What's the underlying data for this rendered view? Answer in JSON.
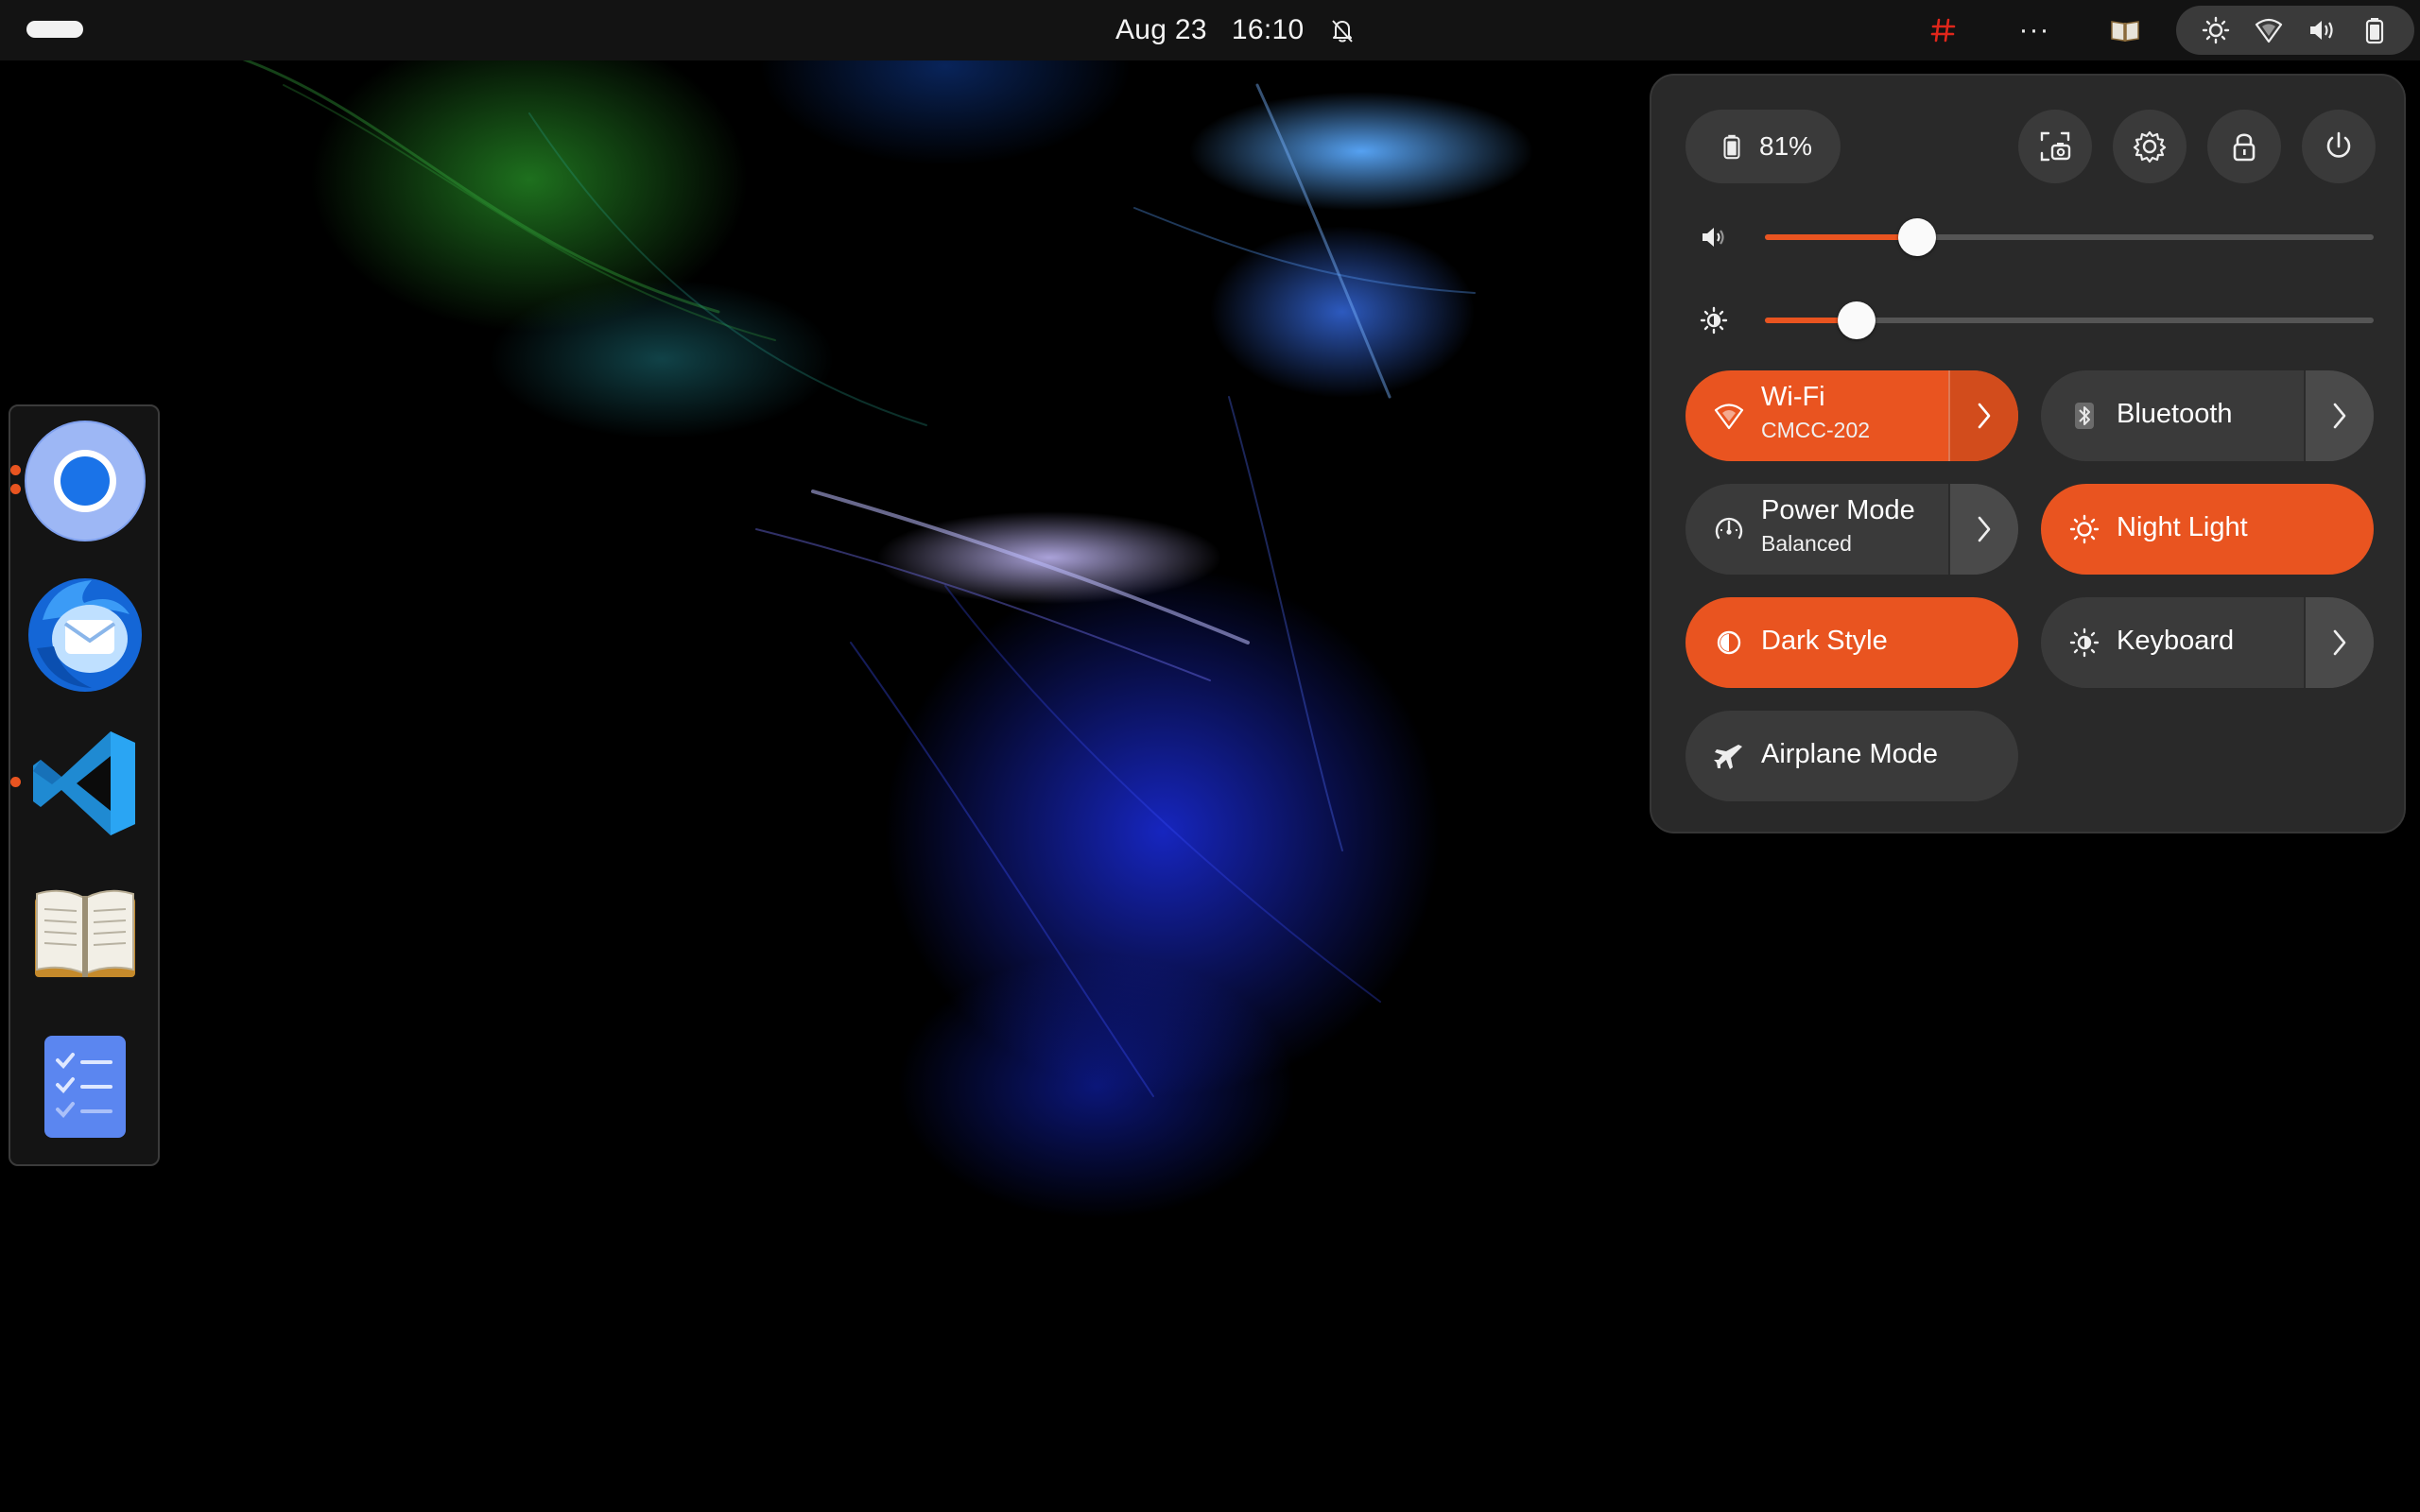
{
  "topbar": {
    "date": "Aug 23",
    "time": "16:10",
    "icons": [
      "activities-indicator",
      "notifications-muted-icon",
      "app-tray-icon",
      "more-icon",
      "book-tray-icon",
      "night-light-icon",
      "wifi-icon",
      "volume-icon",
      "battery-icon"
    ],
    "ellipsis": "···"
  },
  "dock": {
    "apps": [
      "Chromium",
      "Thunderbird",
      "Visual Studio Code",
      "Bookworm",
      "Planify"
    ]
  },
  "quick_settings": {
    "battery_label": "81%",
    "volume_level": 0.25,
    "brightness_level": 0.15,
    "tiles": {
      "wifi": {
        "label": "Wi-Fi",
        "subtitle": "CMCC-202",
        "active": true
      },
      "bluetooth": {
        "label": "Bluetooth",
        "active": false
      },
      "power_mode": {
        "label": "Power Mode",
        "subtitle": "Balanced",
        "active": false
      },
      "night_light": {
        "label": "Night Light",
        "active": true
      },
      "dark_style": {
        "label": "Dark Style",
        "active": true
      },
      "keyboard": {
        "label": "Keyboard",
        "active": false
      },
      "airplane_mode": {
        "label": "Airplane Mode",
        "active": false
      }
    }
  },
  "colors": {
    "accent": "#e95420",
    "panel": "#292929",
    "tile": "#3a3a3a",
    "topbar": "#131313"
  }
}
